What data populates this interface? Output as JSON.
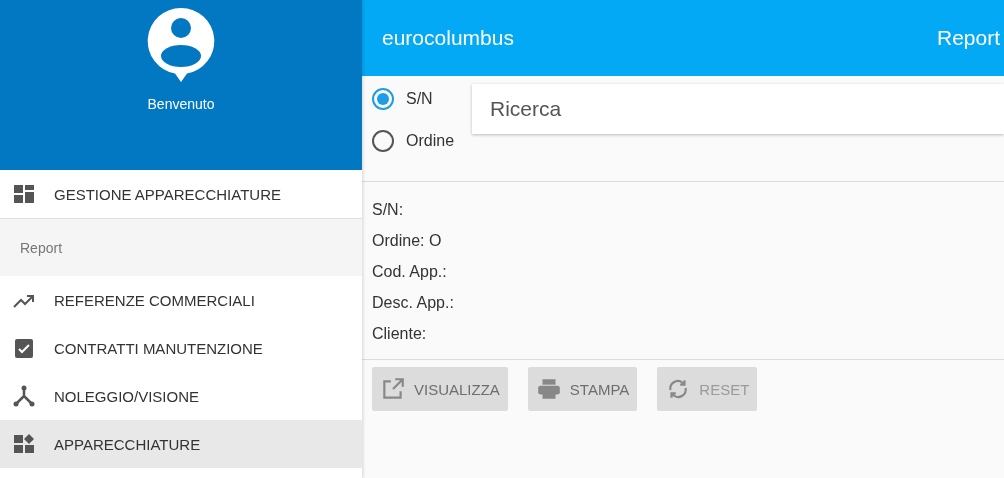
{
  "sidebar": {
    "greeting": "Benvenuto",
    "items": [
      {
        "kind": "item",
        "label": "GESTIONE APPARECCHIATURE",
        "selected": false
      },
      {
        "kind": "header",
        "label": "Report"
      },
      {
        "kind": "item",
        "label": "REFERENZE COMMERCIALI",
        "selected": false
      },
      {
        "kind": "item",
        "label": "CONTRATTI MANUTENZIONE",
        "selected": false
      },
      {
        "kind": "item",
        "label": "NOLEGGIO/VISIONE",
        "selected": false
      },
      {
        "kind": "item",
        "label": "APPARECCHIATURE",
        "selected": true
      }
    ]
  },
  "topbar": {
    "title": "eurocolumbus",
    "right": "Report"
  },
  "search_mode": [
    {
      "label": "S/N",
      "selected": true
    },
    {
      "label": "Ordine",
      "selected": false
    }
  ],
  "search": {
    "placeholder": "Ricerca"
  },
  "details": [
    "S/N:",
    "Ordine: O",
    "Cod. App.:",
    "Desc. App.:",
    "Cliente:"
  ],
  "buttons": [
    {
      "label": "VISUALIZZA",
      "kind": "normal"
    },
    {
      "label": "STAMPA",
      "kind": "normal"
    },
    {
      "label": "RESET",
      "kind": "faded"
    }
  ]
}
